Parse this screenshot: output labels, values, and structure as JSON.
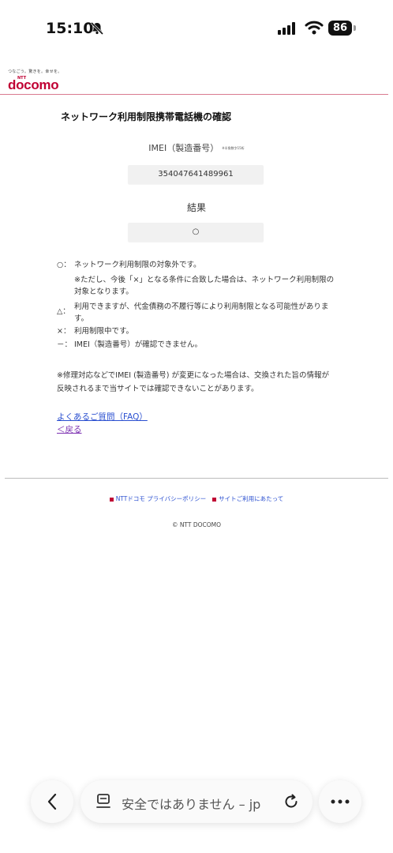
{
  "status_bar": {
    "time": "15:10",
    "battery": "86"
  },
  "header": {
    "tagline": "つなごう。驚きを。幸せを。",
    "logo_ntt": "NTT",
    "logo_text": "docomo"
  },
  "page_title": "ネットワーク利用制限携帯電話機の確認",
  "imei": {
    "label": "IMEI（製造番号）",
    "note": "※半角数字15桁",
    "value": "354047641489961"
  },
  "result": {
    "label": "結果",
    "value": "○"
  },
  "legend": [
    {
      "symbol": "○：",
      "text": "ネットワーク利用制限の対象外です。"
    },
    {
      "symbol": "△：",
      "text": "利用できますが、代金債務の不履行等により利用制限となる可能性があります。"
    },
    {
      "symbol": "×：",
      "text": "利用制限中です。"
    },
    {
      "symbol": "－：",
      "text": "IMEI（製造番号）が確認できません。"
    }
  ],
  "legend_sub": "※ただし、今後「×」となる条件に合致した場合は、ネットワーク利用制限の対象となります。",
  "note": "※修理対応などでIMEI (製造番号) が変更になった場合は、交換された旨の情報が反映されるまで当サイトでは確認できないことがあります。",
  "links": {
    "faq": "よくあるご質問（FAQ）",
    "back": "＜戻る"
  },
  "footer": {
    "privacy": "NTTドコモ プライバシーポリシー",
    "terms": "サイトご利用にあたって",
    "copyright": "© NTT DOCOMO"
  },
  "browser": {
    "address": "安全ではありません – jp"
  },
  "colors": {
    "brand": "#c00033",
    "link": "#2a4fd0",
    "visited": "#7b2fb0"
  },
  "icons": [
    "bell-slash-icon",
    "signal-icon",
    "wifi-icon",
    "back-chevron-icon",
    "page-icon",
    "reload-icon",
    "more-icon"
  ]
}
